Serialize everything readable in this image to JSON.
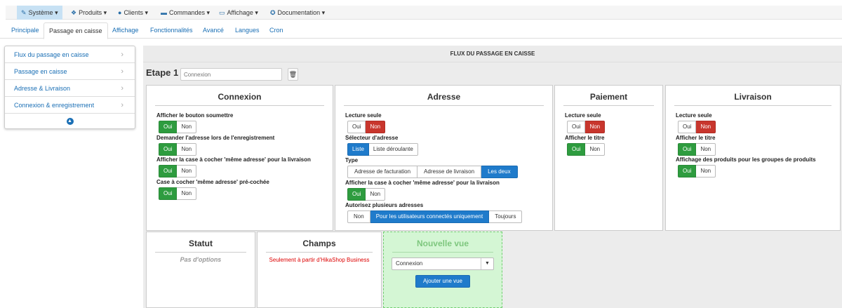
{
  "menu": [
    {
      "label": "Système",
      "icon": "wrench-icon",
      "glyph": "✎",
      "active": true
    },
    {
      "label": "Produits",
      "icon": "cubes-icon",
      "glyph": "❖"
    },
    {
      "label": "Clients",
      "icon": "user-icon",
      "glyph": "●"
    },
    {
      "label": "Commandes",
      "icon": "credit-card-icon",
      "glyph": "▬"
    },
    {
      "label": "Affichage",
      "icon": "monitor-icon",
      "glyph": "▭"
    },
    {
      "label": "Documentation",
      "icon": "lifebuoy-icon",
      "glyph": "✪"
    }
  ],
  "tabs": [
    "Principale",
    "Passage en caisse",
    "Affichage",
    "Fonctionnalités",
    "Avancé",
    "Langues",
    "Cron"
  ],
  "active_tab": "Passage en caisse",
  "sidebar": {
    "items": [
      {
        "label": "Flux du passage en caisse"
      },
      {
        "label": "Passage en caisse"
      },
      {
        "label": "Adresse & Livraison"
      },
      {
        "label": "Connexion & enregistrement"
      }
    ],
    "collapse_icon": "chevron-up-circle-icon"
  },
  "workflow": {
    "header": "FLUX DU PASSAGE EN CAISSE",
    "step_label": "Etape 1",
    "step_placeholder": "Connexion",
    "delete_icon": "trash-icon"
  },
  "panels": {
    "connexion": {
      "title": "Connexion",
      "options": [
        {
          "label": "Afficher le bouton soumettre",
          "buttons": [
            "Oui",
            "Non"
          ],
          "selected": "Oui"
        },
        {
          "label": "Demander l'adresse lors de l'enregistrement",
          "buttons": [
            "Oui",
            "Non"
          ],
          "selected": "Oui"
        },
        {
          "label": "Afficher la case à cocher 'même adresse' pour la livraison",
          "buttons": [
            "Oui",
            "Non"
          ],
          "selected": "Oui"
        },
        {
          "label": "Case à cocher 'même adresse' pré-cochée",
          "buttons": [
            "Oui",
            "Non"
          ],
          "selected": "Oui"
        }
      ]
    },
    "adresse": {
      "title": "Adresse",
      "options": [
        {
          "label": "Lecture seule",
          "buttons": [
            "Oui",
            "Non"
          ],
          "selected": "Non"
        },
        {
          "label": "Sélecteur d'adresse",
          "buttons": [
            "Liste",
            "Liste déroulante"
          ],
          "selected": "Liste"
        },
        {
          "label": "Type",
          "buttons": [
            "Adresse de facturation",
            "Adresse de livraison",
            "Les deux"
          ],
          "selected": "Les deux"
        },
        {
          "label": "Afficher la case à cocher 'même adresse' pour la livraison",
          "buttons": [
            "Oui",
            "Non"
          ],
          "selected": "Oui"
        },
        {
          "label": "Autorisez plusieurs adresses",
          "buttons": [
            "Non",
            "Pour les utilisateurs connectés uniquement",
            "Toujours"
          ],
          "selected": "Pour les utilisateurs connectés uniquement"
        }
      ]
    },
    "paiement": {
      "title": "Paiement",
      "options": [
        {
          "label": "Lecture seule",
          "buttons": [
            "Oui",
            "Non"
          ],
          "selected": "Non"
        },
        {
          "label": "Afficher le titre",
          "buttons": [
            "Oui",
            "Non"
          ],
          "selected": "Oui"
        }
      ]
    },
    "livraison": {
      "title": "Livraison",
      "options": [
        {
          "label": "Lecture seule",
          "buttons": [
            "Oui",
            "Non"
          ],
          "selected": "Non"
        },
        {
          "label": "Afficher le titre",
          "buttons": [
            "Oui",
            "Non"
          ],
          "selected": "Oui"
        },
        {
          "label": "Affichage des produits pour les groupes de produits",
          "buttons": [
            "Oui",
            "Non"
          ],
          "selected": "Oui"
        }
      ]
    },
    "statut": {
      "title": "Statut",
      "note": "Pas d'options"
    },
    "champs": {
      "title": "Champs",
      "note": "Seulement à partir d'HikaShop Business"
    },
    "nouvelle_vue": {
      "title": "Nouvelle vue",
      "select_value": "Connexion",
      "add_label": "Ajouter une vue"
    }
  },
  "colors": {
    "accent": "#1f7bcb",
    "yes": "#2e9c3f",
    "no": "#c8362d",
    "new_view_bg": "#d4f6d4"
  }
}
